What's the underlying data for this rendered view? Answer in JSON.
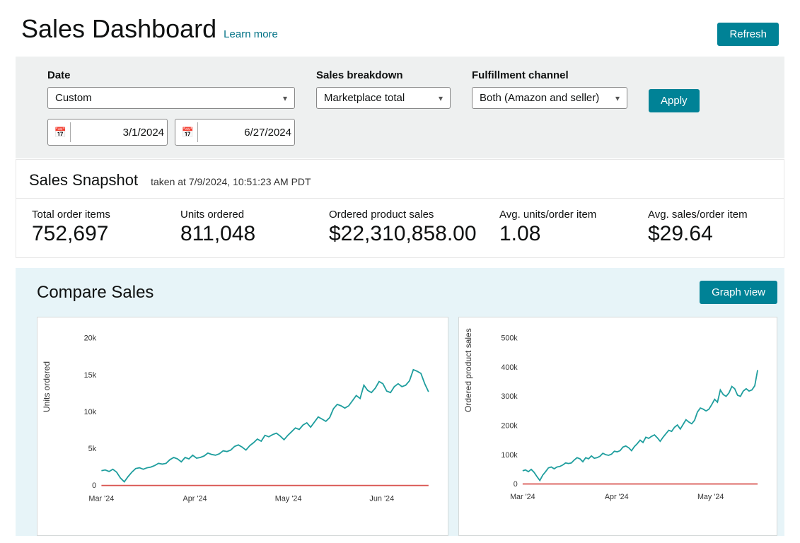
{
  "header": {
    "title": "Sales Dashboard",
    "learn_more": "Learn more",
    "refresh": "Refresh"
  },
  "filters": {
    "date_label": "Date",
    "date_range_selected": "Custom",
    "date_from": "3/1/2024",
    "date_to": "6/27/2024",
    "breakdown_label": "Sales breakdown",
    "breakdown_selected": "Marketplace total",
    "channel_label": "Fulfillment channel",
    "channel_selected": "Both (Amazon and seller)",
    "apply": "Apply"
  },
  "snapshot": {
    "title": "Sales Snapshot",
    "taken_at": "taken at 7/9/2024, 10:51:23 AM PDT",
    "metrics": [
      {
        "label": "Total order items",
        "value": "752,697"
      },
      {
        "label": "Units ordered",
        "value": "811,048"
      },
      {
        "label": "Ordered product sales",
        "value": "$22,310,858.00"
      },
      {
        "label": "Avg. units/order item",
        "value": "1.08"
      },
      {
        "label": "Avg. sales/order item",
        "value": "$29.64"
      }
    ]
  },
  "compare": {
    "title": "Compare Sales",
    "graph_view": "Graph view"
  },
  "chart_data": [
    {
      "type": "line",
      "ylabel": "Units ordered",
      "ylim": [
        0,
        20000
      ],
      "yticks": [
        0,
        5000,
        10000,
        15000,
        20000
      ],
      "ytick_labels": [
        "0",
        "5k",
        "10k",
        "15k",
        "20k"
      ],
      "xticks": [
        "Mar '24",
        "Apr '24",
        "May '24",
        "Jun '24"
      ],
      "series": [
        {
          "name": "units",
          "color": "#1f9e9e",
          "values": [
            2000,
            2100,
            1900,
            2200,
            1800,
            1000,
            500,
            1200,
            1800,
            2300,
            2400,
            2200,
            2400,
            2500,
            2700,
            3000,
            2900,
            3000,
            3500,
            3800,
            3600,
            3200,
            3800,
            3600,
            4100,
            3700,
            3800,
            4000,
            4400,
            4200,
            4100,
            4300,
            4700,
            4600,
            4800,
            5300,
            5500,
            5200,
            4800,
            5400,
            5800,
            6300,
            6000,
            6800,
            6600,
            6900,
            7100,
            6700,
            6200,
            6800,
            7300,
            7800,
            7600,
            8200,
            8500,
            7900,
            8600,
            9300,
            9000,
            8700,
            9200,
            10400,
            11000,
            10800,
            10500,
            10800,
            11500,
            12200,
            11800,
            13600,
            12900,
            12600,
            13200,
            14100,
            13800,
            12800,
            12600,
            13400,
            13800,
            13400,
            13600,
            14200,
            15700,
            15500,
            15200,
            13800,
            12700
          ]
        },
        {
          "name": "baseline",
          "color": "#d9534f",
          "values": [
            0,
            0,
            0,
            0,
            0,
            0,
            0,
            0,
            0,
            0,
            0,
            0,
            0,
            0,
            0,
            0,
            0,
            0,
            0,
            0,
            0,
            0,
            0,
            0,
            0,
            0,
            0,
            0,
            0,
            0,
            0,
            0,
            0,
            0,
            0,
            0,
            0,
            0,
            0,
            0,
            0,
            0,
            0,
            0,
            0,
            0,
            0,
            0,
            0,
            0,
            0,
            0,
            0,
            0,
            0,
            0,
            0,
            0,
            0,
            0,
            0,
            0,
            0,
            0,
            0,
            0,
            0,
            0,
            0,
            0,
            0,
            0,
            0,
            0,
            0,
            0,
            0,
            0,
            0,
            0,
            0,
            0,
            0,
            0,
            0,
            0,
            0
          ]
        }
      ]
    },
    {
      "type": "line",
      "ylabel": "Ordered product sales",
      "ylim": [
        0,
        500000
      ],
      "yticks": [
        0,
        100000,
        200000,
        300000,
        400000,
        500000
      ],
      "ytick_labels": [
        "0",
        "100k",
        "200k",
        "300k",
        "400k",
        "500k"
      ],
      "xticks": [
        "Mar '24",
        "Apr '24",
        "May '24"
      ],
      "series": [
        {
          "name": "sales",
          "color": "#1f9e9e",
          "values": [
            45000,
            48000,
            42000,
            50000,
            40000,
            25000,
            12000,
            30000,
            42000,
            55000,
            58000,
            52000,
            58000,
            60000,
            65000,
            72000,
            70000,
            72000,
            82000,
            90000,
            86000,
            76000,
            90000,
            86000,
            96000,
            88000,
            90000,
            95000,
            105000,
            100000,
            98000,
            102000,
            112000,
            110000,
            114000,
            126000,
            130000,
            124000,
            114000,
            128000,
            138000,
            150000,
            142000,
            160000,
            156000,
            163000,
            168000,
            158000,
            146000,
            160000,
            172000,
            184000,
            180000,
            194000,
            202000,
            188000,
            204000,
            220000,
            212000,
            206000,
            218000,
            246000,
            260000,
            256000,
            250000,
            256000,
            272000,
            290000,
            280000,
            322000,
            306000,
            300000,
            312000,
            334000,
            326000,
            304000,
            300000,
            318000,
            326000,
            318000,
            322000,
            336000,
            390000
          ]
        },
        {
          "name": "baseline",
          "color": "#d9534f",
          "values": [
            0,
            0,
            0,
            0,
            0,
            0,
            0,
            0,
            0,
            0,
            0,
            0,
            0,
            0,
            0,
            0,
            0,
            0,
            0,
            0,
            0,
            0,
            0,
            0,
            0,
            0,
            0,
            0,
            0,
            0,
            0,
            0,
            0,
            0,
            0,
            0,
            0,
            0,
            0,
            0,
            0,
            0,
            0,
            0,
            0,
            0,
            0,
            0,
            0,
            0,
            0,
            0,
            0,
            0,
            0,
            0,
            0,
            0,
            0,
            0,
            0,
            0,
            0,
            0,
            0,
            0,
            0,
            0,
            0,
            0,
            0,
            0,
            0,
            0,
            0,
            0,
            0,
            0,
            0,
            0,
            0,
            0,
            0
          ]
        }
      ]
    }
  ]
}
